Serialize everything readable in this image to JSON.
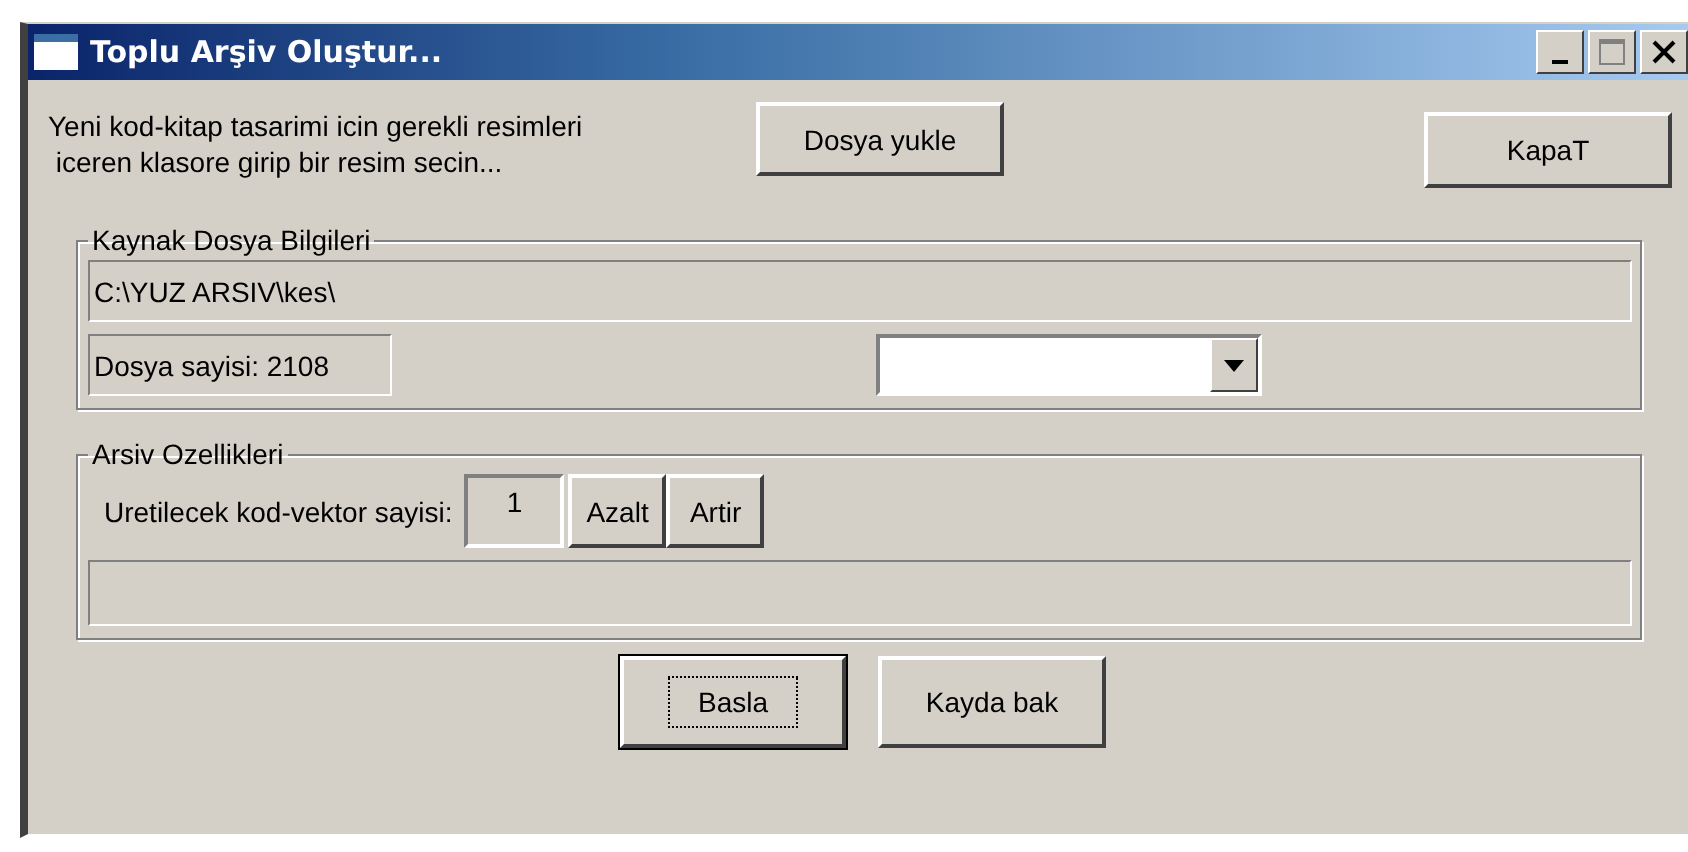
{
  "window": {
    "title": "Toplu Arşiv Oluştur..."
  },
  "intro": {
    "text": "Yeni kod-kitap tasarimi icin gerekli resimleri\n iceren klasore girip bir resim secin...",
    "load_button": "Dosya yukle",
    "close_button": "KapaT"
  },
  "source_group": {
    "legend": "Kaynak Dosya Bilgileri",
    "path": "C:\\YUZ ARSIV\\kes\\",
    "file_count": "Dosya sayisi: 2108"
  },
  "archive_group": {
    "legend": "Arsiv Ozellikleri",
    "count_label": "Uretilecek kod-vektor sayisi:",
    "count_value": "1",
    "decrease_button": "Azalt",
    "increase_button": "Artir"
  },
  "buttons": [
    {
      "label": "Basla",
      "focused": true
    },
    {
      "label": "Kayda bak",
      "focused": false
    }
  ]
}
